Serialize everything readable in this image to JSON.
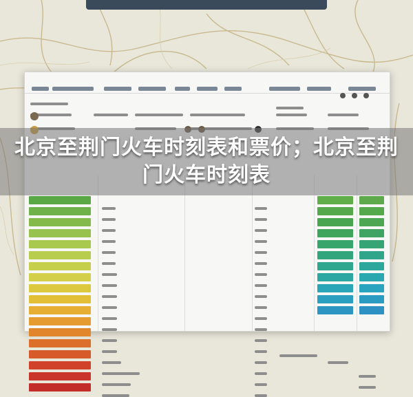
{
  "title": "北京至荆门火车时刻表和票价；北京至荆门火车时刻表",
  "colors": {
    "map_bg": "#e9e6da",
    "road": "#c9b98e",
    "banner": "#3a4a5a",
    "title_band": "#787878",
    "title_text": "#ffffff",
    "heat_green": "#8ec24a",
    "heat_yellow": "#e3c33a",
    "heat_orange": "#e08a2e",
    "heat_red": "#c8322a",
    "teal": "#2aa6b8"
  }
}
